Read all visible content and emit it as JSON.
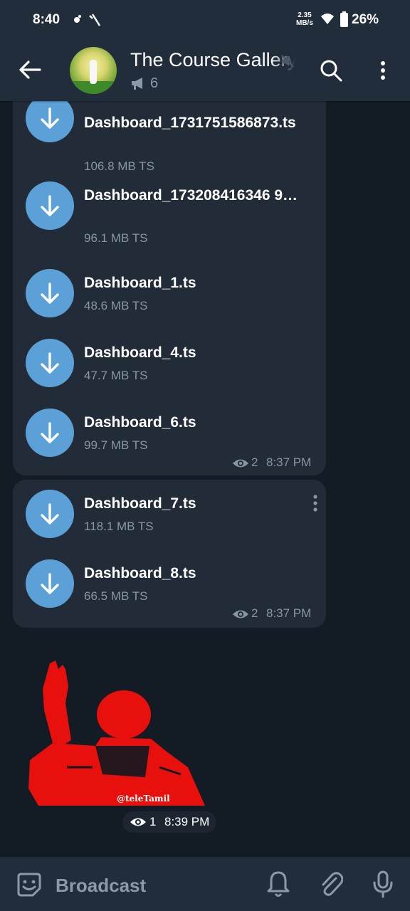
{
  "status_bar": {
    "time": "8:40",
    "speed_value": "2.35",
    "speed_unit": "MB/s",
    "battery": "26%"
  },
  "header": {
    "title": "The Course Gallery",
    "subscriber_count": "6"
  },
  "messages": [
    {
      "files": [
        {
          "name": "Dashboard_1731751586873.ts",
          "size": "106.8 MB TS"
        },
        {
          "name": "Dashboard_173208416346 9…",
          "size": "96.1 MB TS"
        },
        {
          "name": "Dashboard_1.ts",
          "size": "48.6 MB TS"
        },
        {
          "name": "Dashboard_4.ts",
          "size": "47.7 MB TS"
        },
        {
          "name": "Dashboard_6.ts",
          "size": "99.7 MB TS"
        }
      ],
      "views": "2",
      "time": "8:37 PM"
    },
    {
      "files": [
        {
          "name": "Dashboard_7.ts",
          "size": "118.1 MB TS"
        },
        {
          "name": "Dashboard_8.ts",
          "size": "66.5 MB TS"
        }
      ],
      "views": "2",
      "time": "8:37 PM"
    }
  ],
  "sticker": {
    "watermark": "@teleTamil",
    "views": "1",
    "time": "8:39 PM"
  },
  "bottom_bar": {
    "placeholder": "Broadcast"
  },
  "colors": {
    "accent": "#5ca0d8",
    "bubble": "#222c38",
    "background": "#131b24",
    "header": "#212d3b",
    "sticker_red": "#e8100c"
  },
  "icons": [
    "back-arrow-icon",
    "mute-icon",
    "megaphone-icon",
    "search-icon",
    "more-vert-icon",
    "download-icon",
    "eye-icon",
    "emoji-icon",
    "bell-icon",
    "paperclip-icon",
    "mic-icon"
  ]
}
